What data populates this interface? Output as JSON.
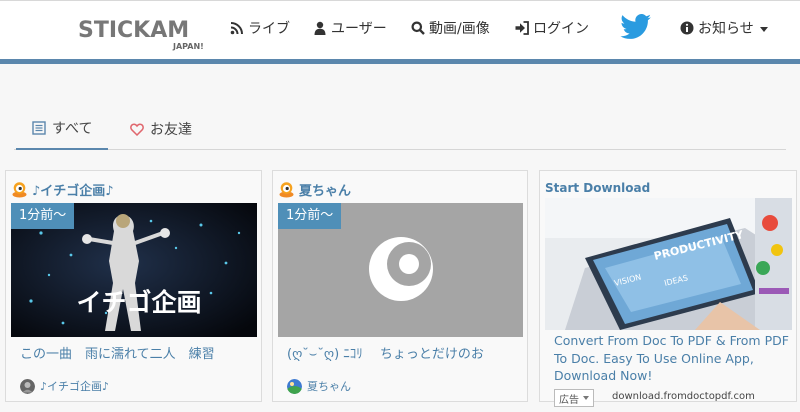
{
  "header": {
    "logo_main": "STICKAM",
    "logo_sub": "JAPAN!",
    "nav": {
      "live": "ライブ",
      "user": "ユーザー",
      "video": "動画/画像",
      "login": "ログイン",
      "info": "お知らせ"
    },
    "icons": {
      "live": "rss-icon",
      "user": "user-icon",
      "video": "search-icon",
      "login": "sign-in-icon",
      "twitter": "twitter-icon",
      "info": "info-circle-icon"
    }
  },
  "tabs": [
    {
      "label": "すべて",
      "active": true
    },
    {
      "label": "お友達",
      "active": false
    }
  ],
  "cards": [
    {
      "channel": "♪イチゴ企画♪",
      "badge": "1分前～",
      "thumb_text": "イチゴ企画",
      "title": "この一曲　雨に濡れて二人　練習",
      "user": "♪イチゴ企画♪"
    },
    {
      "channel": "夏ちゃん",
      "badge": "1分前～",
      "title": "(ღ˘⌣˘ღ) ﾆｺﾘ　 ちょっとだけのお",
      "user": "夏ちゃん"
    }
  ],
  "ad": {
    "heading": "Start Download",
    "image_words": [
      "PRODUCTIVITY",
      "VISION",
      "IDEAS"
    ],
    "text": "Convert From Doc To PDF & From PDF To Doc. Easy To Use Online App, Download Now!",
    "label": "広告",
    "domain": "download.fromdoctopdf.com"
  },
  "colors": {
    "accent": "#5b87ad",
    "link": "#4a7fa8",
    "badge": "#4f8fb8",
    "twitter": "#2a9be0"
  }
}
